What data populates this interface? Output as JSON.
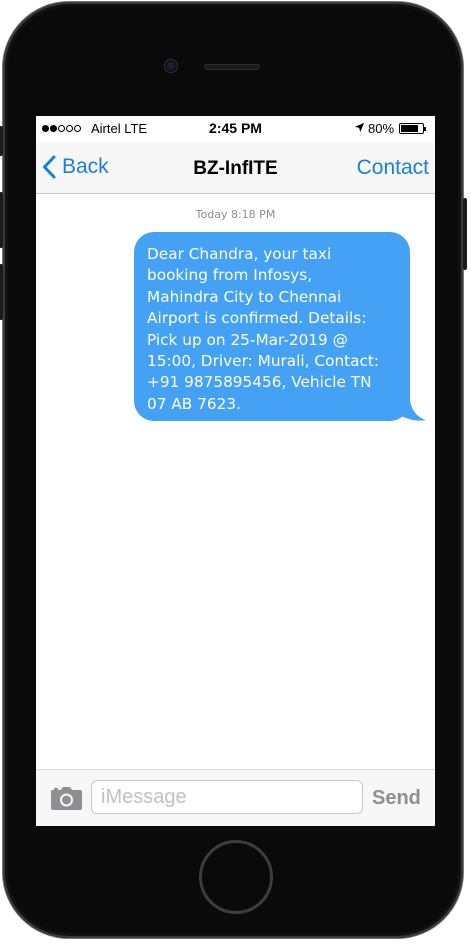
{
  "status_bar": {
    "carrier": "Airtel LTE",
    "time": "2:45 PM",
    "battery_percent": "80%",
    "battery_level": 0.8,
    "signal_bars_filled": 2,
    "signal_bars_total": 5,
    "icons": [
      "signal-dots-icon",
      "location-arrow-icon",
      "battery-icon"
    ]
  },
  "nav": {
    "back_label": "Back",
    "title": "BZ-InfITE",
    "contact_label": "Contact"
  },
  "conversation": {
    "timestamp": "Today 8:18 PM",
    "messages": [
      {
        "text": "Dear Chandra, your taxi\nbooking from Infosys,\nMahindra City to Chennai\nAirport is confirmed. Details:\nPick up on 25-Mar-2019 @\n15:00, Driver: Murali, Contact:\n+91 9875895456, Vehicle TN\n07 AB 7623.",
        "bubble_color": "#44a1f3"
      }
    ]
  },
  "input_bar": {
    "placeholder": "iMessage",
    "value": "",
    "send_label": "Send"
  },
  "colors": {
    "accent": "#1a7fd6",
    "bubble": "#44a1f3",
    "device": "#0a0a0a"
  }
}
